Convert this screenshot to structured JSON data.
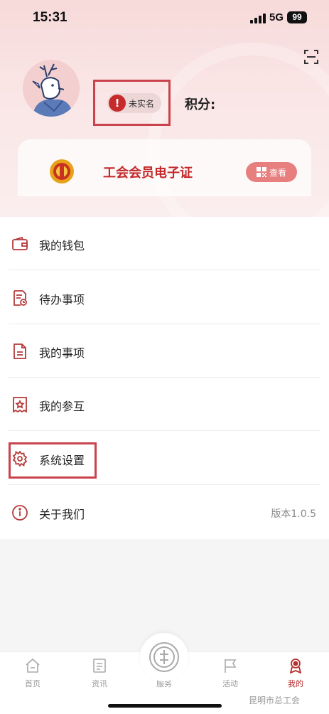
{
  "status_bar": {
    "time": "15:31",
    "network": "5G",
    "battery": "99"
  },
  "profile": {
    "realname_status": "未实名",
    "points_label": "积分:"
  },
  "member_card": {
    "title": "工会会员电子证",
    "view_button": "查看"
  },
  "menu": {
    "items": [
      {
        "label": "我的钱包",
        "icon": "wallet-icon"
      },
      {
        "label": "待办事项",
        "icon": "todo-icon"
      },
      {
        "label": "我的事项",
        "icon": "document-icon"
      },
      {
        "label": "我的参互",
        "icon": "star-badge-icon"
      },
      {
        "label": "系统设置",
        "icon": "gear-icon"
      },
      {
        "label": "关于我们",
        "icon": "info-icon",
        "value": "版本1.0.5"
      }
    ]
  },
  "tabbar": {
    "tabs": [
      {
        "label": "首页",
        "icon": "home-icon"
      },
      {
        "label": "资讯",
        "icon": "news-icon"
      },
      {
        "label": "服务",
        "icon": "service-icon"
      },
      {
        "label": "活动",
        "icon": "flag-icon"
      },
      {
        "label": "我的",
        "icon": "profile-icon",
        "active": true
      }
    ]
  },
  "watermark": "昆明市总工会",
  "colors": {
    "accent": "#c32a2a",
    "highlight_outline": "#c9424c",
    "header_bg": "#f7dada"
  }
}
